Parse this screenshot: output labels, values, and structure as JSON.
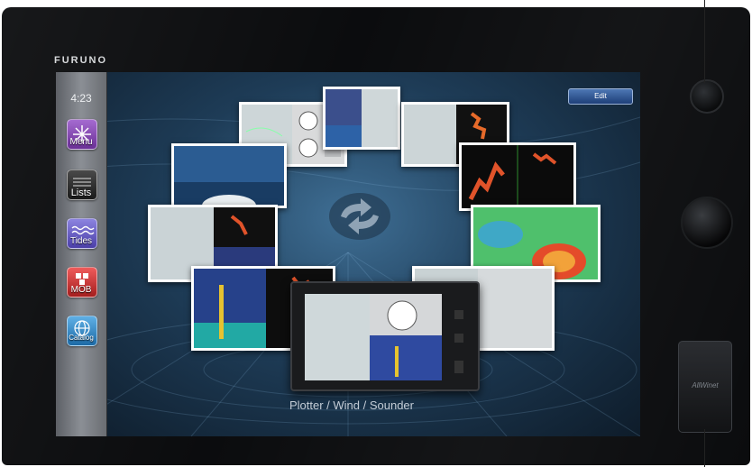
{
  "brand": "FURUNO",
  "clock": "4:23",
  "edit_button": "Edit",
  "sidebar": {
    "items": [
      {
        "label": "Menu",
        "icon": "menu-icon",
        "color": "#8a4db3"
      },
      {
        "label": "Lists",
        "icon": "list-icon",
        "color": "#2c2c2c"
      },
      {
        "label": "Tides",
        "icon": "tides-icon",
        "color": "#6a5fc4"
      },
      {
        "label": "MOB",
        "icon": "mob-icon",
        "color": "#d23b3b"
      },
      {
        "label": "Catalog",
        "icon": "globe-icon",
        "color": "#3f8fc8"
      }
    ]
  },
  "carousel": {
    "selected_caption": "Plotter / Wind / Sounder",
    "center_control": "rotate-arrows-icon"
  },
  "hardware": {
    "port_label": "AllWinet"
  }
}
